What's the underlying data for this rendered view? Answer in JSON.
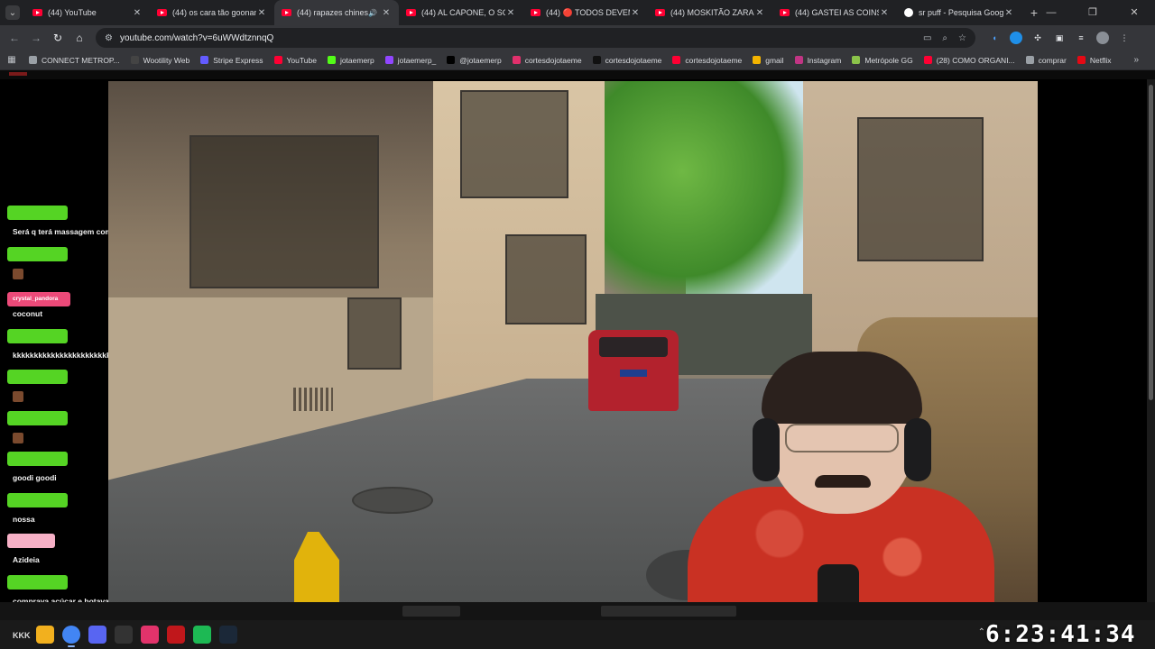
{
  "tabs": [
    {
      "label": "(44) YouTube",
      "active": false
    },
    {
      "label": "(44) os cara tão goonano",
      "active": false
    },
    {
      "label": "(44) rapazes chineses",
      "active": true,
      "audio": true
    },
    {
      "label": "(44) AL CAPONE, O SCARI",
      "active": false
    },
    {
      "label": "(44) 🔴 TODOS DEVEM F",
      "active": false
    },
    {
      "label": "(44) MOSKITÃO ZARALHA",
      "active": false
    },
    {
      "label": "(44) GASTEI AS COINS DO",
      "active": false
    },
    {
      "label": "sr puff - Pesquisa Google",
      "active": false,
      "google": true
    }
  ],
  "address": {
    "url": "youtube.com/watch?v=6uWWdtznnqQ"
  },
  "bookmarks": [
    {
      "label": "CONNECT METROP...",
      "color": "#9aa0a6"
    },
    {
      "label": "Wootility Web",
      "color": "#444"
    },
    {
      "label": "Stripe Express",
      "color": "#635bff"
    },
    {
      "label": "YouTube",
      "color": "#ff0033"
    },
    {
      "label": "jotaemerp",
      "color": "#53fc18"
    },
    {
      "label": "jotaemerp_",
      "color": "#9146ff"
    },
    {
      "label": "@jotaemerp",
      "color": "#000"
    },
    {
      "label": "cortesdojotaeme",
      "color": "#e1306c"
    },
    {
      "label": "cortesdojotaeme",
      "color": "#111"
    },
    {
      "label": "cortesdojotaeme",
      "color": "#ff0033"
    },
    {
      "label": "gmail",
      "color": "#f4b400"
    },
    {
      "label": "Instagram",
      "color": "#c13584"
    },
    {
      "label": "Metrópole GG",
      "color": "#8bc34a"
    },
    {
      "label": "(28) COMO ORGANI...",
      "color": "#ff0033"
    },
    {
      "label": "comprar",
      "color": "#9aa0a6"
    },
    {
      "label": "Netflix",
      "color": "#e50914"
    }
  ],
  "chat": {
    "messages": [
      {
        "user": "",
        "badge": "green",
        "text": "Será q terá massagem com final?"
      },
      {
        "user": "",
        "badge": "green",
        "emote": true
      },
      {
        "user": "crystal_pandora",
        "badge": "pink",
        "text": "coconut"
      },
      {
        "user": "",
        "badge": "green",
        "text": "kkkkkkkkkkkkkkkkkkkkkkk"
      },
      {
        "user": "",
        "badge": "green",
        "emote": true
      },
      {
        "user": "",
        "badge": "green",
        "emote": true
      },
      {
        "user": "",
        "badge": "green",
        "text": "goodi goodi"
      },
      {
        "user": "",
        "badge": "green",
        "text": "nossa"
      },
      {
        "user": "",
        "badge": "lpink",
        "text": "Azideia"
      },
      {
        "user": "",
        "badge": "green",
        "text": "comprava açúcar e botava"
      },
      {
        "user": "",
        "badge": "lpink",
        "text": ""
      }
    ]
  },
  "taskbar": {
    "left_label": "KKK",
    "clock_big": "6:23:41:34",
    "apps": [
      {
        "name": "file-explorer",
        "color": "#f2b01e"
      },
      {
        "name": "chrome",
        "color": "#4285f4"
      },
      {
        "name": "discord",
        "color": "#5865f2"
      },
      {
        "name": "obs",
        "color": "#333"
      },
      {
        "name": "adobe",
        "color": "#e2336b"
      },
      {
        "name": "roblox-studio",
        "color": "#c0171b"
      },
      {
        "name": "spotify",
        "color": "#1db954"
      },
      {
        "name": "steam",
        "color": "#1b2838"
      }
    ]
  }
}
